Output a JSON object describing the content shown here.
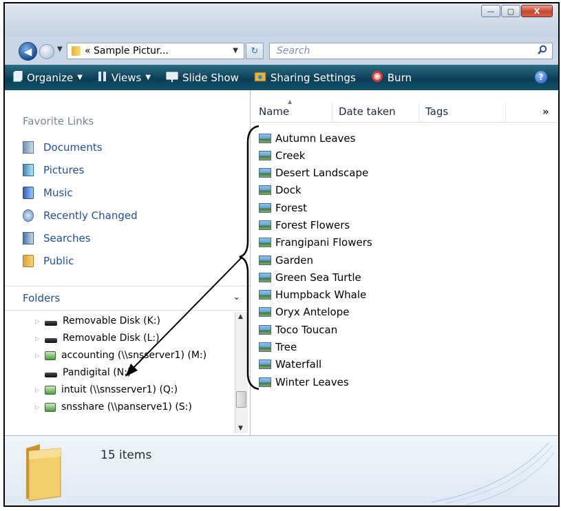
{
  "window": {
    "caption_buttons": {
      "minimize": "—",
      "maximize": "▢",
      "close": "X"
    }
  },
  "address_bar": {
    "path_text": "« Sample Pictur...",
    "refresh_symbol": "↻",
    "search_placeholder": "Search"
  },
  "toolbar": {
    "organize_label": "Organize",
    "views_label": "Views",
    "slideshow_label": "Slide Show",
    "sharing_label": "Sharing Settings",
    "burn_label": "Burn",
    "help_label": "?"
  },
  "nav_pane": {
    "favorites_title": "Favorite Links",
    "favorites": [
      {
        "label": "Documents",
        "icon": "documents-icon"
      },
      {
        "label": "Pictures",
        "icon": "pictures-icon"
      },
      {
        "label": "Music",
        "icon": "music-icon"
      },
      {
        "label": "Recently Changed",
        "icon": "recently-changed-icon"
      },
      {
        "label": "Searches",
        "icon": "searches-icon"
      },
      {
        "label": "Public",
        "icon": "public-folder-icon"
      }
    ],
    "folders_title": "Folders",
    "folders_tree": [
      {
        "label": "Removable Disk (K:)",
        "type": "drive"
      },
      {
        "label": "Removable Disk (L:)",
        "type": "drive"
      },
      {
        "label": "accounting (\\\\snsserver1) (M:)",
        "type": "network"
      },
      {
        "label": "Pandigital (N:)",
        "type": "drive"
      },
      {
        "label": "intuit (\\\\snsserver1) (Q:)",
        "type": "network"
      },
      {
        "label": "snsshare (\\\\panserve1) (S:)",
        "type": "network"
      }
    ]
  },
  "file_list": {
    "columns": [
      "Name",
      "Date taken",
      "Tags"
    ],
    "more_columns": "»",
    "files": [
      "Autumn Leaves",
      "Creek",
      "Desert Landscape",
      "Dock",
      "Forest",
      "Forest Flowers",
      "Frangipani Flowers",
      "Garden",
      "Green Sea Turtle",
      "Humpback Whale",
      "Oryx Antelope",
      "Toco Toucan",
      "Tree",
      "Waterfall",
      "Winter Leaves"
    ]
  },
  "details_pane": {
    "items_count": "15 items"
  },
  "colors": {
    "toolbar": "#0c3f57",
    "link_blue": "#1e4fa8",
    "annotation": "#000000"
  }
}
